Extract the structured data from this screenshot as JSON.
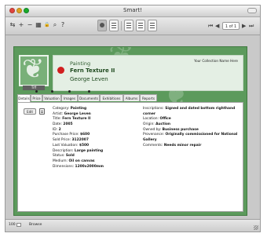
{
  "window": {
    "title": "Smart!"
  },
  "toolbar": {
    "buttons": [
      {
        "icon": "back-forward-icon",
        "glyph": "⇆"
      },
      {
        "icon": "plus-icon",
        "glyph": "+"
      },
      {
        "icon": "minus-icon",
        "glyph": "−"
      },
      {
        "icon": "grid-icon",
        "glyph": "▦"
      },
      {
        "icon": "lock-icon",
        "glyph": "🔒"
      },
      {
        "icon": "search-icon",
        "glyph": "⌕"
      },
      {
        "icon": "help-icon",
        "glyph": "?"
      }
    ],
    "record_counter": "1 of 1"
  },
  "record": {
    "thumbnail_caption": "Tiff",
    "type": "Painting",
    "title": "Fern Texture II",
    "artist": "George Leven",
    "collection_name": "Your Collection Name Here"
  },
  "tabs": [
    "Details",
    "Price",
    "Valuation",
    "Images",
    "Documents",
    "Exhibitions",
    "Albums",
    "Reports"
  ],
  "active_tab": "Details",
  "details": {
    "edit_label": "Edit",
    "left_fields": [
      {
        "label": "Category:",
        "value": "Painting"
      },
      {
        "label": "Artist:",
        "value": "George Leven"
      },
      {
        "label": "Title:",
        "value": "Fern Texture II"
      },
      {
        "label": "Date:",
        "value": "2005"
      },
      {
        "label": "ID:",
        "value": "2"
      },
      {
        "label": "Purchase Price:",
        "value": "$600"
      },
      {
        "label": "Sold Price:",
        "value": "3122007"
      },
      {
        "label": "Last Valuation:",
        "value": "$500"
      },
      {
        "label": "Description:",
        "value": "Large painting"
      },
      {
        "label": "Status:",
        "value": "Sold"
      },
      {
        "label": "Medium:",
        "value": "Oil on canvas"
      },
      {
        "label": "Dimensions:",
        "value": "1200x2000mm"
      }
    ],
    "right_fields": [
      {
        "label": "Inscriptions:",
        "value": "Signed and dated bottom righthand corner"
      },
      {
        "label": "Location:",
        "value": "Office"
      },
      {
        "label": "Origin:",
        "value": "Auction"
      },
      {
        "label": "Owned by:",
        "value": "Business purchase"
      },
      {
        "label": "Provenance:",
        "value": "Originally commissioned for National Gallery"
      },
      {
        "label": "Comments:",
        "value": "Needs minor repair"
      }
    ]
  },
  "statusbar": {
    "zoom": "100",
    "mode": "Browse"
  },
  "colors": {
    "card_green": "#5c9a5c",
    "header_panel": "#e4efe4",
    "status_red": "#d11f1f"
  }
}
